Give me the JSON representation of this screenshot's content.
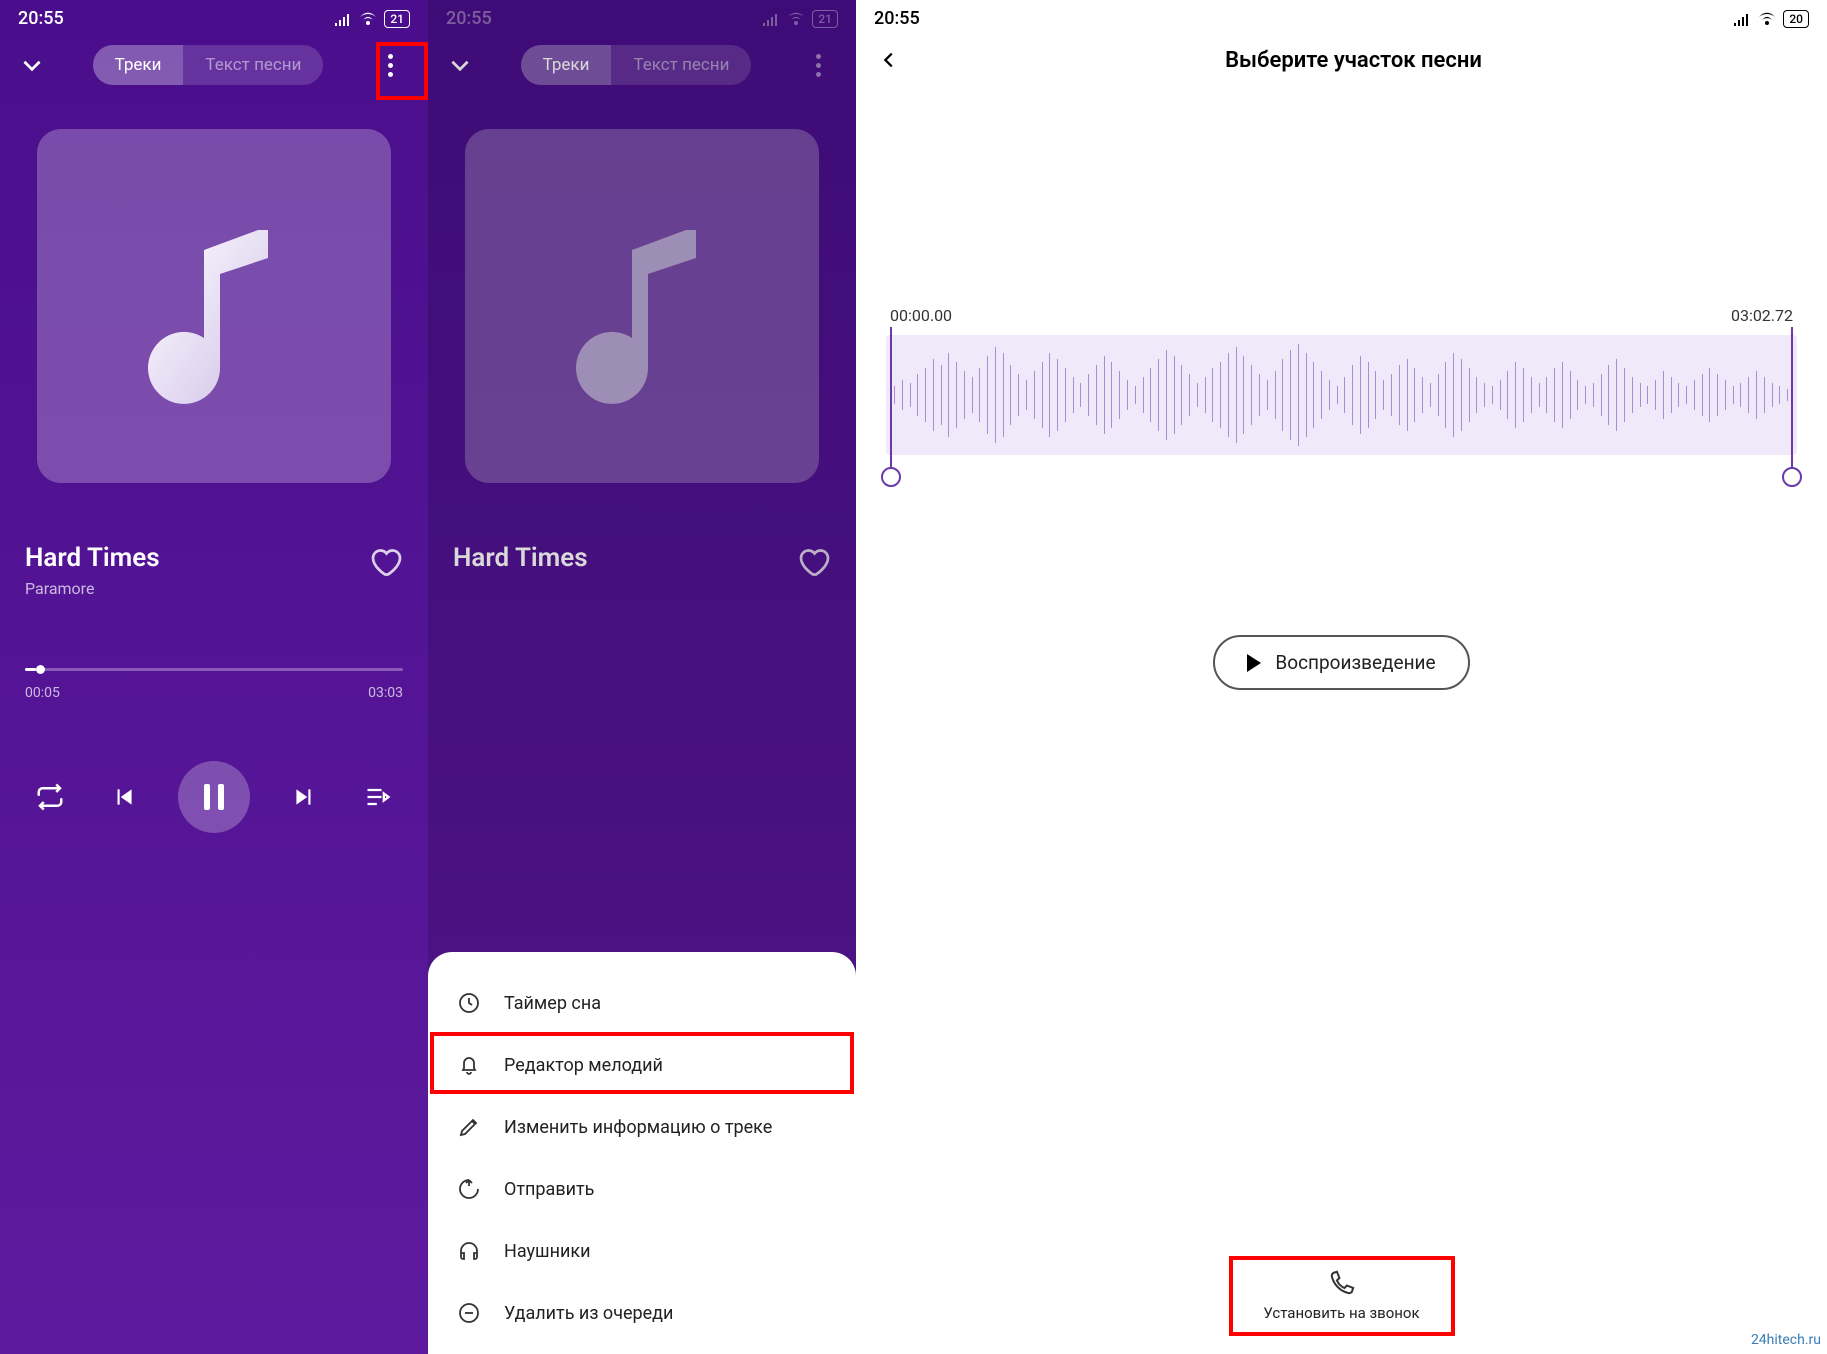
{
  "status": {
    "time": "20:55",
    "battery1": "21",
    "battery3": "20"
  },
  "tabs": {
    "tracks": "Треки",
    "lyrics": "Текст песни"
  },
  "track": {
    "title": "Hard Times",
    "artist": "Paramore"
  },
  "progress": {
    "current": "00:05",
    "total": "03:03"
  },
  "menu": {
    "sleep": "Таймер сна",
    "ringtone_editor": "Редактор мелодий",
    "edit_info": "Изменить информацию о треке",
    "share": "Отправить",
    "headphones": "Наушники",
    "remove_queue": "Удалить из очереди"
  },
  "editor": {
    "title": "Выберите участок песни",
    "start": "00:00.00",
    "end": "03:02.72",
    "play": "Воспроизведение",
    "set_ringtone": "Установить на звонок"
  },
  "watermark": "24hitech.ru"
}
